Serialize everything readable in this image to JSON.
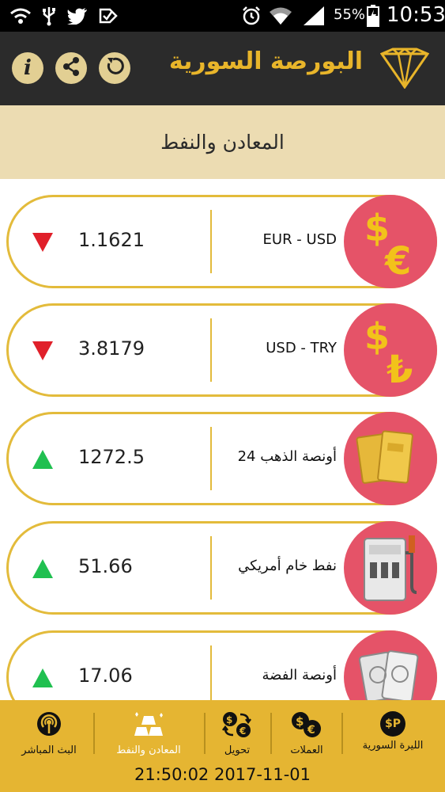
{
  "status_bar": {
    "battery": "55%",
    "time": "10:53",
    "left_icons": [
      "wifi-hotspot-icon",
      "usb-icon",
      "twitter-icon",
      "check-icon"
    ],
    "right_icons": [
      "alarm-icon",
      "wifi-icon",
      "signal-icon",
      "battery-icon"
    ]
  },
  "app_bar": {
    "title": "البورصة السورية",
    "buttons": [
      "info-icon",
      "share-icon",
      "refresh-icon"
    ],
    "info_glyph": "i"
  },
  "section": {
    "title": "المعادن والنفط"
  },
  "items": [
    {
      "label": "EUR - USD",
      "value": "1.1621",
      "trend": "down",
      "icon": "dollar-euro-icon"
    },
    {
      "label": "USD - TRY",
      "value": "3.8179",
      "trend": "down",
      "icon": "dollar-lira-icon"
    },
    {
      "label": "أونصة الذهب 24",
      "value": "1272.5",
      "trend": "up",
      "icon": "gold-bars-icon"
    },
    {
      "label": "نفط خام أمريكي",
      "value": "51.66",
      "trend": "up",
      "icon": "fuel-pump-icon"
    },
    {
      "label": "أونصة الفضة",
      "value": "17.06",
      "trend": "up",
      "icon": "silver-bars-icon"
    }
  ],
  "bottom_nav": [
    {
      "label": "الليرة السورية",
      "icon": "syrian-pound-icon",
      "active": false,
      "glyph": "$P"
    },
    {
      "label": "العملات",
      "icon": "currencies-icon",
      "active": false
    },
    {
      "label": "تحويل",
      "icon": "exchange-icon",
      "active": false
    },
    {
      "label": "المعادن والنفط",
      "icon": "metals-icon",
      "active": true
    },
    {
      "label": "البث المباشر",
      "icon": "live-broadcast-icon",
      "active": false
    }
  ],
  "datetime": "21:50:02 2017-11-01",
  "colors": {
    "accent": "#e5b532",
    "header": "#2b2b2b",
    "section_bg": "#ecdcb2",
    "card_border": "#e3bb3b",
    "icon_circle": "#e55368",
    "down": "#e0202a",
    "up": "#20c050"
  }
}
